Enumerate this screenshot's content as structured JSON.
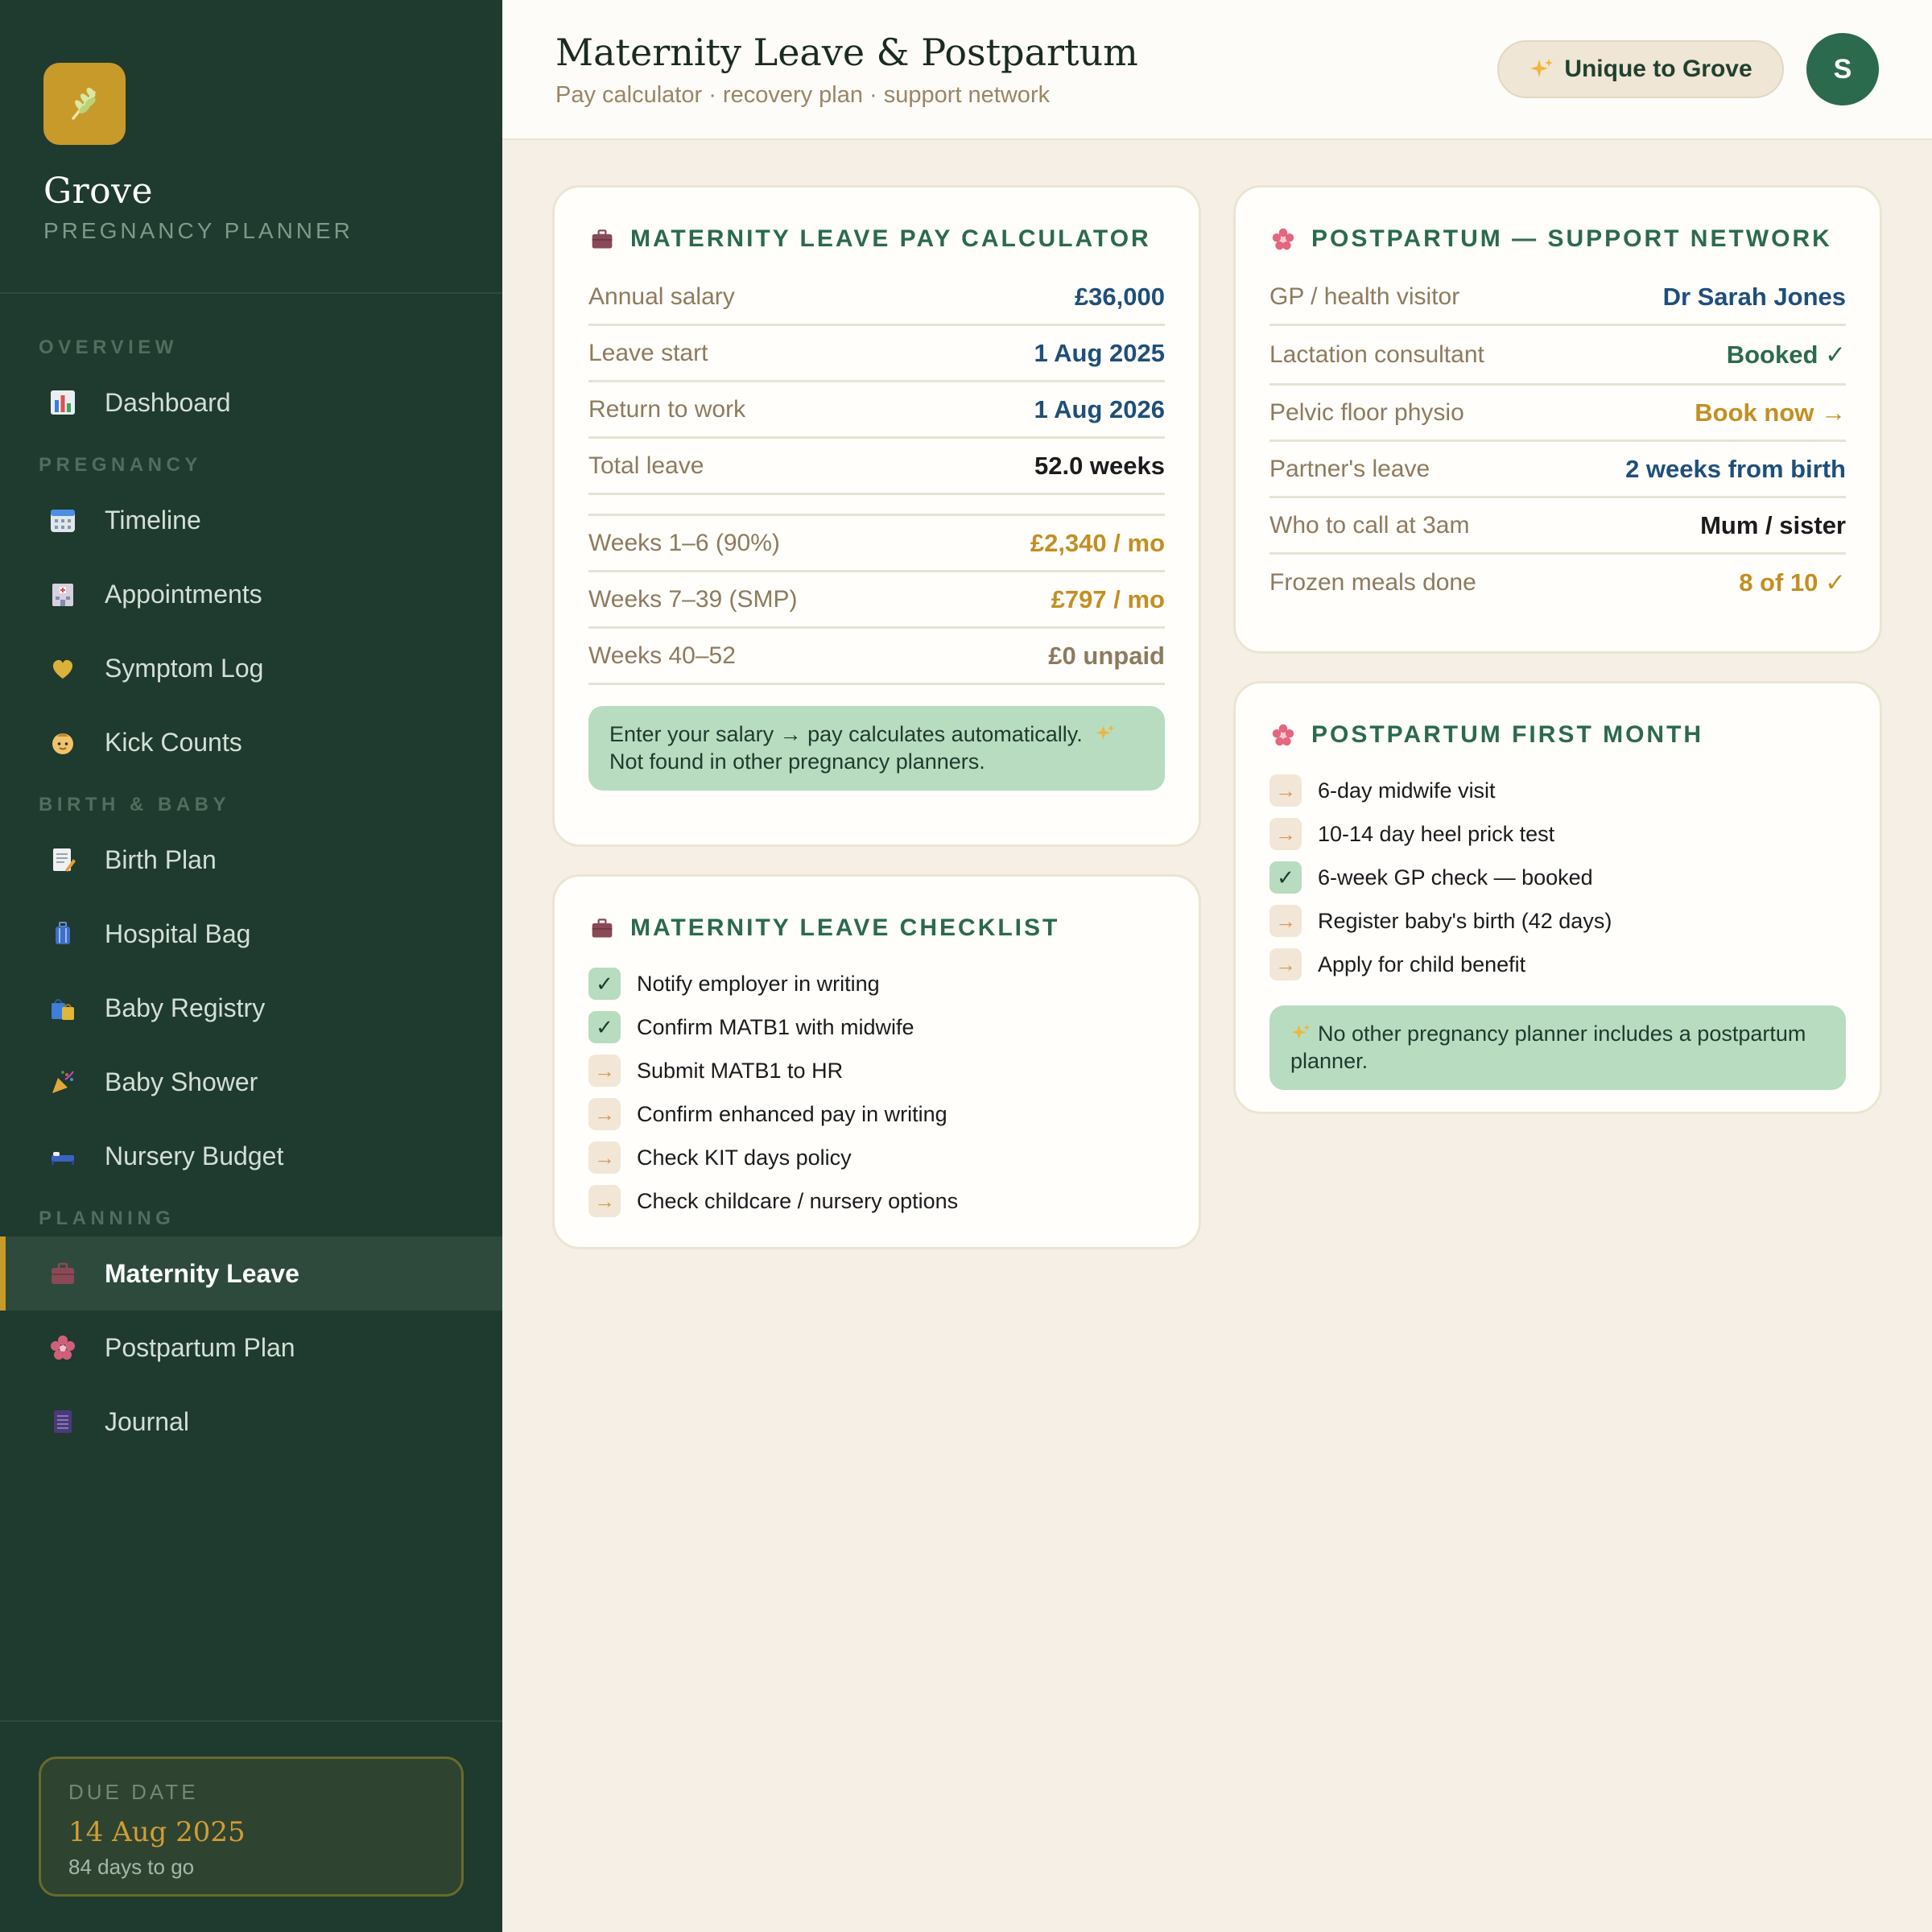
{
  "brand": {
    "name": "Grove",
    "subtitle": "PREGNANCY PLANNER",
    "logo_icon": "wheat-sprig-icon"
  },
  "nav": {
    "sections": [
      {
        "label": "OVERVIEW",
        "items": [
          {
            "label": "Dashboard",
            "icon": "bar-chart-icon"
          }
        ]
      },
      {
        "label": "PREGNANCY",
        "items": [
          {
            "label": "Timeline",
            "icon": "calendar-icon"
          },
          {
            "label": "Appointments",
            "icon": "hospital-icon"
          },
          {
            "label": "Symptom Log",
            "icon": "heart-icon"
          },
          {
            "label": "Kick Counts",
            "icon": "baby-icon"
          }
        ]
      },
      {
        "label": "BIRTH & BABY",
        "items": [
          {
            "label": "Birth Plan",
            "icon": "memo-icon"
          },
          {
            "label": "Hospital Bag",
            "icon": "luggage-icon"
          },
          {
            "label": "Baby Registry",
            "icon": "shopping-bags-icon"
          },
          {
            "label": "Baby Shower",
            "icon": "party-popper-icon"
          },
          {
            "label": "Nursery Budget",
            "icon": "bed-icon"
          }
        ]
      },
      {
        "label": "PLANNING",
        "items": [
          {
            "label": "Maternity Leave",
            "icon": "briefcase-icon",
            "active": true
          },
          {
            "label": "Postpartum Plan",
            "icon": "blossom-icon"
          },
          {
            "label": "Journal",
            "icon": "notebook-icon"
          }
        ]
      }
    ]
  },
  "due": {
    "label": "DUE DATE",
    "date": "14 Aug 2025",
    "countdown": "84 days to go"
  },
  "header": {
    "title": "Maternity Leave & Postpartum",
    "subtitle": "Pay calculator · recovery plan · support network",
    "unique_label": "Unique to Grove",
    "avatar_initial": "S"
  },
  "pay_calculator": {
    "title": "MATERNITY LEAVE PAY CALCULATOR",
    "rows": [
      {
        "label": "Annual salary",
        "value": "£36,000"
      },
      {
        "label": "Leave start",
        "value": "1 Aug 2025"
      },
      {
        "label": "Return to work",
        "value": "1 Aug 2026"
      },
      {
        "label": "Total leave",
        "value": "52.0 weeks"
      }
    ],
    "pay_rows": [
      {
        "label": "Weeks 1–6 (90%)",
        "value": "£2,340 / mo"
      },
      {
        "label": "Weeks 7–39 (SMP)",
        "value": "£797 / mo"
      },
      {
        "label": "Weeks 40–52",
        "value": "£0 unpaid"
      }
    ],
    "note_line1": "Enter your salary → pay calculates automatically.",
    "note_line2": "Not found in other pregnancy planners."
  },
  "leave_checklist": {
    "title": "MATERNITY LEAVE CHECKLIST",
    "items": [
      {
        "label": "Notify employer in writing",
        "done": true
      },
      {
        "label": "Confirm MATB1 with midwife",
        "done": true
      },
      {
        "label": "Submit MATB1 to HR",
        "done": false
      },
      {
        "label": "Confirm enhanced pay in writing",
        "done": false
      },
      {
        "label": "Check KIT days policy",
        "done": false
      },
      {
        "label": "Check childcare / nursery options",
        "done": false
      }
    ],
    "done_mark": "✓",
    "todo_mark": "→"
  },
  "support_network": {
    "title": "POSTPARTUM — SUPPORT NETWORK",
    "rows": [
      {
        "label": "GP / health visitor",
        "value": "Dr Sarah Jones"
      },
      {
        "label": "Lactation consultant",
        "value": "Booked ✓"
      },
      {
        "label": "Pelvic floor physio",
        "value": "Book now →"
      },
      {
        "label": "Partner's leave",
        "value": "2 weeks from birth"
      },
      {
        "label": "Who to call at 3am",
        "value": "Mum / sister"
      },
      {
        "label": "Frozen meals done",
        "value": "8 of 10 ✓"
      }
    ]
  },
  "first_month": {
    "title": "POSTPARTUM FIRST MONTH",
    "items": [
      {
        "label": "6-day midwife visit",
        "done": false
      },
      {
        "label": "10-14 day heel prick test",
        "done": false
      },
      {
        "label": "6-week GP check — booked",
        "done": true
      },
      {
        "label": "Register baby's birth (42 days)",
        "done": false
      },
      {
        "label": "Apply for child benefit",
        "done": false
      }
    ],
    "note": "No other pregnancy planner includes a postpartum planner."
  },
  "colors": {
    "sidebar_bg": "#1f3a2e",
    "accent_gold": "#c89a2a",
    "accent_green": "#2b6a4c",
    "value_blue": "#1f4f7a",
    "note_green": "#b7dcbf",
    "page_bg": "#f5efe5"
  }
}
